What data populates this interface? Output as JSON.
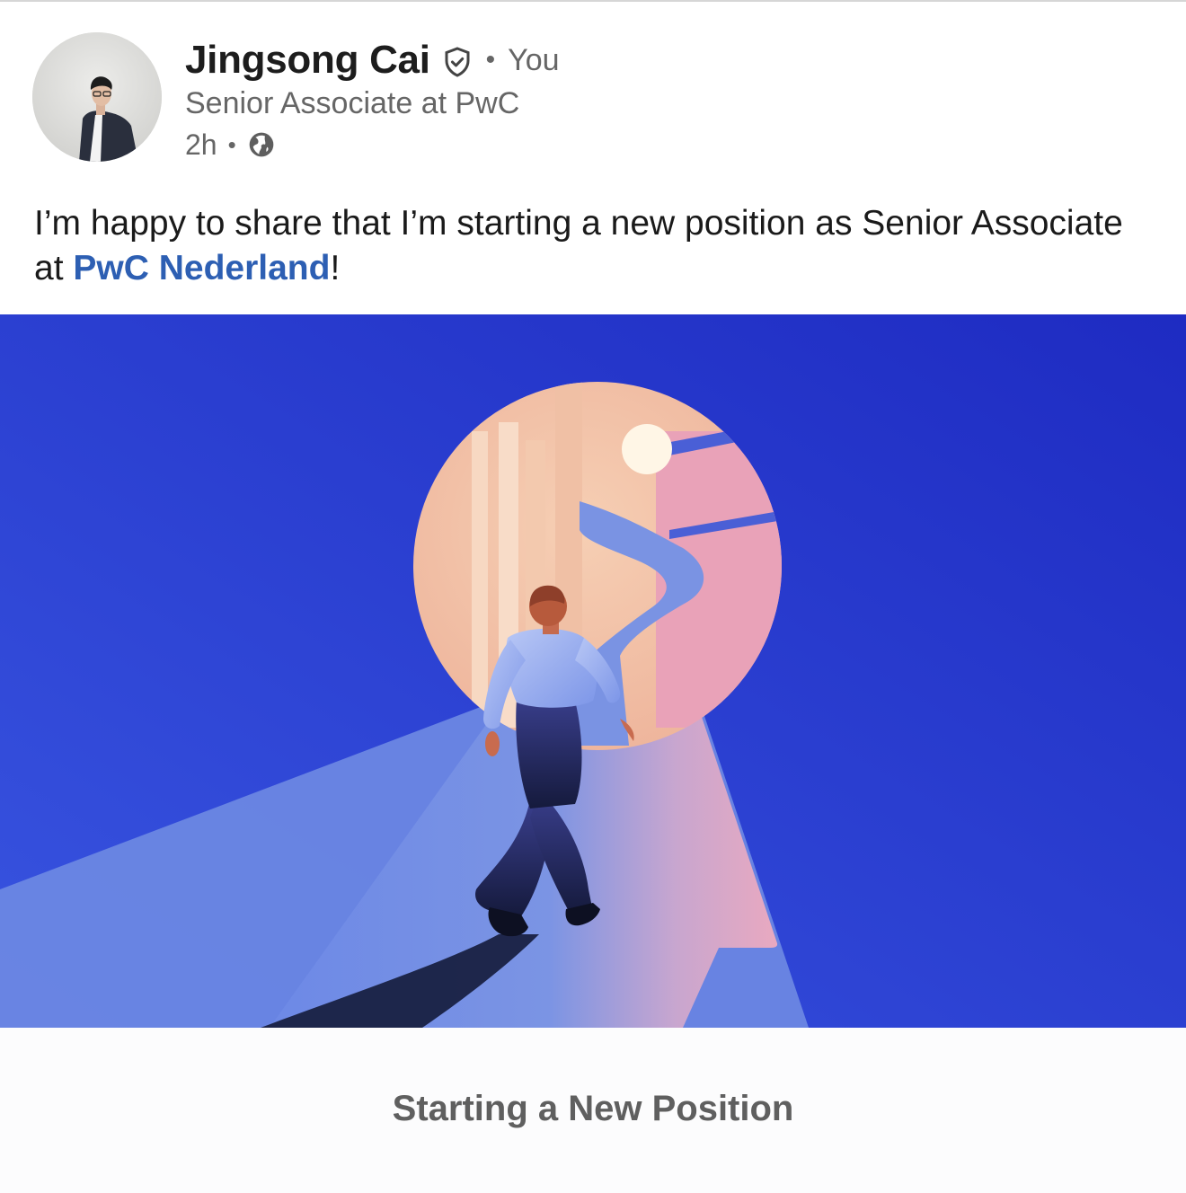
{
  "author": {
    "name": "Jingsong Cai",
    "relation": "You",
    "headline": "Senior Associate at PwC",
    "time": "2h",
    "verified_icon": "verified-shield-icon",
    "visibility_icon": "globe-icon"
  },
  "post": {
    "text_before": "I’m happy to share that I’m starting a new position as Senior Associate at ",
    "mention": "PwC Nederland",
    "text_after": "!"
  },
  "media": {
    "caption": "Starting a New Position",
    "colors": {
      "background": "#2a3fd6",
      "path": "#7e9be6",
      "keyhole_glow": "#f2c2a4",
      "mention": "#2d5fb3"
    }
  },
  "separator": "•"
}
